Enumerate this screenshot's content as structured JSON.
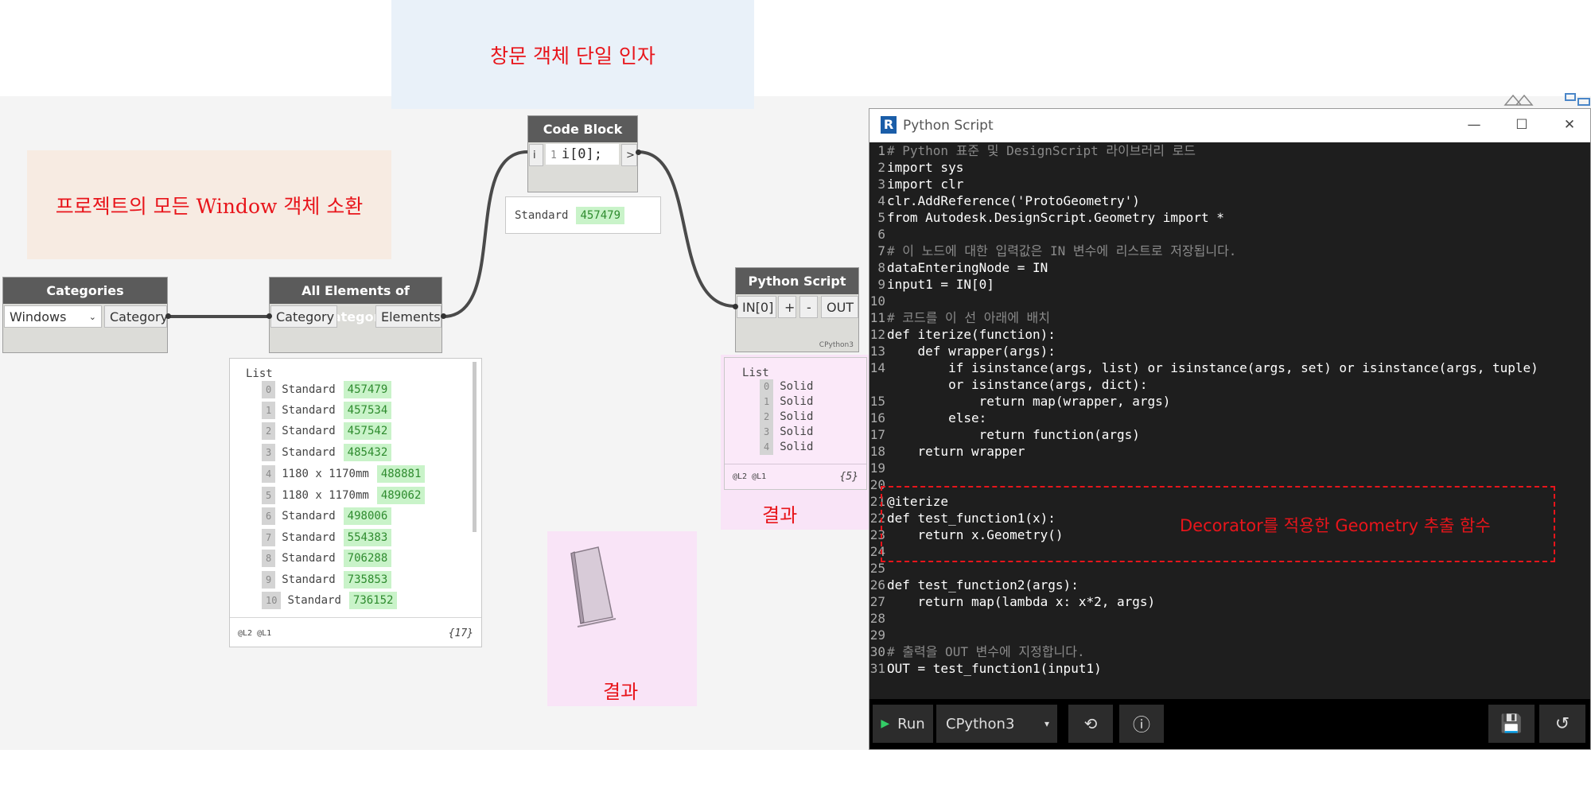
{
  "notes": {
    "top": "창문 객체 단일 인자",
    "left": "프로젝트의 모든 Window 객체 소환",
    "decorator": "Decorator를 적용한 Geometry 추출 함수",
    "result1": "결과",
    "result2": "결과"
  },
  "categories_node": {
    "title": "Categories",
    "dropdown_value": "Windows",
    "output_port": "Category"
  },
  "all_elements_node": {
    "title": "All Elements of Category",
    "input_port": "Category",
    "output_port": "Elements",
    "preview": {
      "header": "List",
      "items": [
        {
          "index": "0",
          "name": "Standard",
          "id": "457479"
        },
        {
          "index": "1",
          "name": "Standard",
          "id": "457534"
        },
        {
          "index": "2",
          "name": "Standard",
          "id": "457542"
        },
        {
          "index": "3",
          "name": "Standard",
          "id": "485432"
        },
        {
          "index": "4",
          "name": "1180 x 1170mm",
          "id": "488881"
        },
        {
          "index": "5",
          "name": "1180 x 1170mm",
          "id": "489062"
        },
        {
          "index": "6",
          "name": "Standard",
          "id": "498006"
        },
        {
          "index": "7",
          "name": "Standard",
          "id": "554383"
        },
        {
          "index": "8",
          "name": "Standard",
          "id": "706288"
        },
        {
          "index": "9",
          "name": "Standard",
          "id": "735853"
        },
        {
          "index": "10",
          "name": "Standard",
          "id": "736152"
        }
      ],
      "levels": "@L2 @L1",
      "count": "{17}"
    }
  },
  "code_block_node": {
    "title": "Code Block",
    "input_port": "i",
    "line_number": "1",
    "code": "i[0];",
    "output_port": ">",
    "preview_name": "Standard",
    "preview_id": "457479"
  },
  "python_node": {
    "title": "Python Script",
    "input_port": "IN[0]",
    "add_label": "+",
    "remove_label": "-",
    "output_port": "OUT",
    "engine": "CPython3",
    "preview": {
      "header": "List",
      "items": [
        {
          "index": "0",
          "value": "Solid"
        },
        {
          "index": "1",
          "value": "Solid"
        },
        {
          "index": "2",
          "value": "Solid"
        },
        {
          "index": "3",
          "value": "Solid"
        },
        {
          "index": "4",
          "value": "Solid"
        }
      ],
      "levels": "@L2 @L1",
      "count": "{5}"
    }
  },
  "python_window": {
    "title": "Python Script",
    "minimize": "—",
    "maximize": "☐",
    "close": "✕",
    "run_label": "Run",
    "engine": "CPython3",
    "code_lines": [
      {
        "n": "1",
        "t": "# Python 표준 및 DesignScript 라이브러리 로드"
      },
      {
        "n": "2",
        "t": "import sys"
      },
      {
        "n": "3",
        "t": "import clr"
      },
      {
        "n": "4",
        "t": "clr.AddReference('ProtoGeometry')"
      },
      {
        "n": "5",
        "t": "from Autodesk.DesignScript.Geometry import *"
      },
      {
        "n": "6",
        "t": ""
      },
      {
        "n": "7",
        "t": "# 이 노드에 대한 입력값은 IN 변수에 리스트로 저장됩니다."
      },
      {
        "n": "8",
        "t": "dataEnteringNode = IN"
      },
      {
        "n": "9",
        "t": "input1 = IN[0]"
      },
      {
        "n": "10",
        "t": ""
      },
      {
        "n": "11",
        "t": "# 코드를 이 선 아래에 배치"
      },
      {
        "n": "12",
        "t": "def iterize(function):"
      },
      {
        "n": "13",
        "t": "    def wrapper(args):"
      },
      {
        "n": "14",
        "t": "        if isinstance(args, list) or isinstance(args, set) or isinstance(args, tuple)"
      },
      {
        "n": "",
        "t": "        or isinstance(args, dict):"
      },
      {
        "n": "15",
        "t": "            return map(wrapper, args)"
      },
      {
        "n": "16",
        "t": "        else:"
      },
      {
        "n": "17",
        "t": "            return function(args)"
      },
      {
        "n": "18",
        "t": "    return wrapper"
      },
      {
        "n": "19",
        "t": ""
      },
      {
        "n": "20",
        "t": ""
      },
      {
        "n": "21",
        "t": "@iterize"
      },
      {
        "n": "22",
        "t": "def test_function1(x):"
      },
      {
        "n": "23",
        "t": "    return x.Geometry()"
      },
      {
        "n": "24",
        "t": ""
      },
      {
        "n": "25",
        "t": ""
      },
      {
        "n": "26",
        "t": "def test_function2(args):"
      },
      {
        "n": "27",
        "t": "    return map(lambda x: x*2, args)"
      },
      {
        "n": "28",
        "t": ""
      },
      {
        "n": "29",
        "t": ""
      },
      {
        "n": "30",
        "t": "# 출력을 OUT 변수에 지정합니다."
      },
      {
        "n": "31",
        "t": "OUT = test_function1(input1)"
      }
    ]
  },
  "colors": {
    "note_text": "#e8151b",
    "node_header": "#5b5b5b",
    "value_green": "#c9f3c9",
    "editor_bg": "#1e1e1e",
    "keyword": "#ff3d7f"
  }
}
